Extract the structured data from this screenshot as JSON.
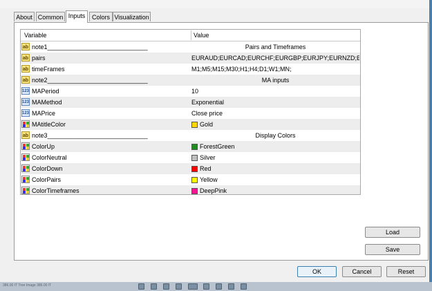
{
  "tabs": [
    {
      "label": "About",
      "active": false
    },
    {
      "label": "Common",
      "active": false
    },
    {
      "label": "Inputs",
      "active": true
    },
    {
      "label": "Colors",
      "active": false
    },
    {
      "label": "Visualization",
      "active": false
    }
  ],
  "table": {
    "col_variable": "Variable",
    "col_value": "Value",
    "rows": [
      {
        "type": "ab",
        "name": "note1_____________________________",
        "value": "Pairs and Timeframes"
      },
      {
        "type": "ab",
        "name": "pairs",
        "value": "EURAUD;EURCAD;EURCHF;EURGBP;EURJPY;EURNZD;E..."
      },
      {
        "type": "ab",
        "name": "timeFrames",
        "value": "M1;M5;M15;M30;H1;H4;D1;W1;MN;"
      },
      {
        "type": "ab",
        "name": "note2_____________________________",
        "value": "MA inputs"
      },
      {
        "type": "num",
        "name": "MAPeriod",
        "value": "10"
      },
      {
        "type": "num",
        "name": "MAMethod",
        "value": "Exponential"
      },
      {
        "type": "num",
        "name": "MAPrice",
        "value": "Close price"
      },
      {
        "type": "clr",
        "name": "MAtitleColor",
        "value": "Gold",
        "swatch": "#ffd700"
      },
      {
        "type": "ab",
        "name": "note3_____________________________",
        "value": "Display Colors"
      },
      {
        "type": "clr",
        "name": "ColorUp",
        "value": "ForestGreen",
        "swatch": "#228b22"
      },
      {
        "type": "clr",
        "name": "ColorNeutral",
        "value": "Silver",
        "swatch": "#c0c0c0"
      },
      {
        "type": "clr",
        "name": "ColorDown",
        "value": "Red",
        "swatch": "#ff0000"
      },
      {
        "type": "clr",
        "name": "ColorPairs",
        "value": "Yellow",
        "swatch": "#ffff00"
      },
      {
        "type": "clr",
        "name": "ColorTimeframes",
        "value": "DeepPink",
        "swatch": "#ff1493"
      }
    ]
  },
  "buttons": {
    "load": "Load",
    "save": "Save",
    "ok": "OK",
    "cancel": "Cancel",
    "reset": "Reset"
  },
  "icons": {
    "string_type": "ab",
    "number_type": "123",
    "color_type": "color-type-icon"
  },
  "taskbar": {
    "text": "386.00 IT Tree Image 386.00 IT"
  }
}
